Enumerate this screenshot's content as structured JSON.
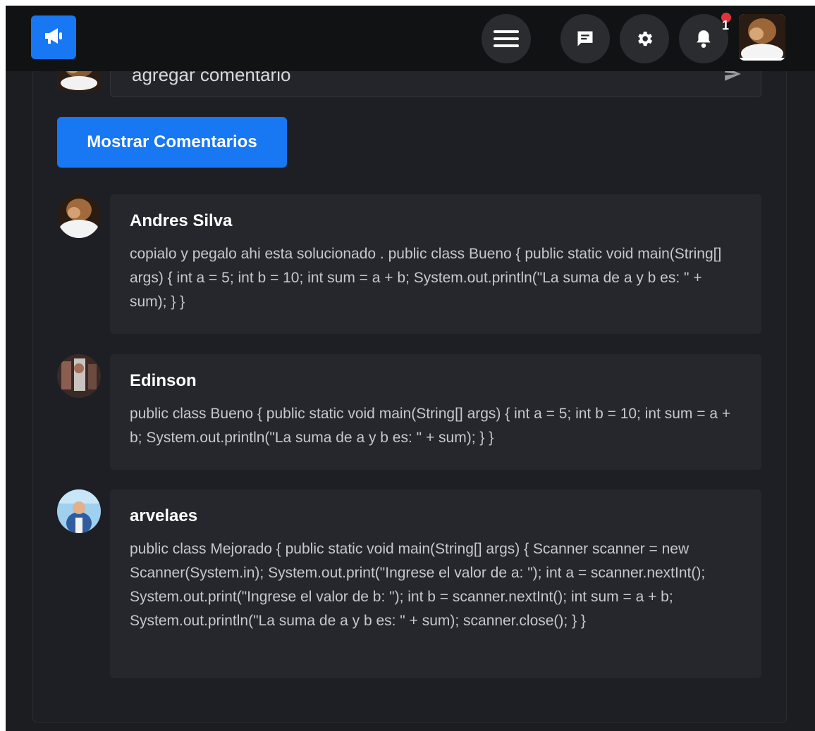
{
  "header": {
    "icons": [
      "megaphone-icon",
      "menu-icon",
      "chat-icon",
      "gear-icon",
      "bell-icon"
    ],
    "notification_count": "1",
    "colors": {
      "accent": "#1877f2",
      "badge": "#e0343d",
      "bar": "#111214"
    }
  },
  "composer": {
    "placeholder": "agregar comentario",
    "send_icon": "send-icon"
  },
  "show_comments_label": "Mostrar Comentarios",
  "comments": [
    {
      "author": "Andres Silva",
      "text": "copialo y pegalo ahi esta solucionado . public class Bueno { public static void main(String[] args) { int a = 5; int b = 10; int sum = a + b; System.out.println(\"La suma de a y b es: \" + sum); } }"
    },
    {
      "author": "Edinson",
      "text": "public class Bueno { public static void main(String[] args) { int a = 5; int b = 10; int sum = a + b; System.out.println(\"La suma de a y b es: \" + sum); } }"
    },
    {
      "author": "arvelaes",
      "text": "public class Mejorado { public static void main(String[] args) { Scanner scanner = new Scanner(System.in); System.out.print(\"Ingrese el valor de a: \"); int a = scanner.nextInt(); System.out.print(\"Ingrese el valor de b: \"); int b = scanner.nextInt(); int sum = a + b; System.out.println(\"La suma de a y b es: \" + sum); scanner.close(); } }"
    }
  ]
}
